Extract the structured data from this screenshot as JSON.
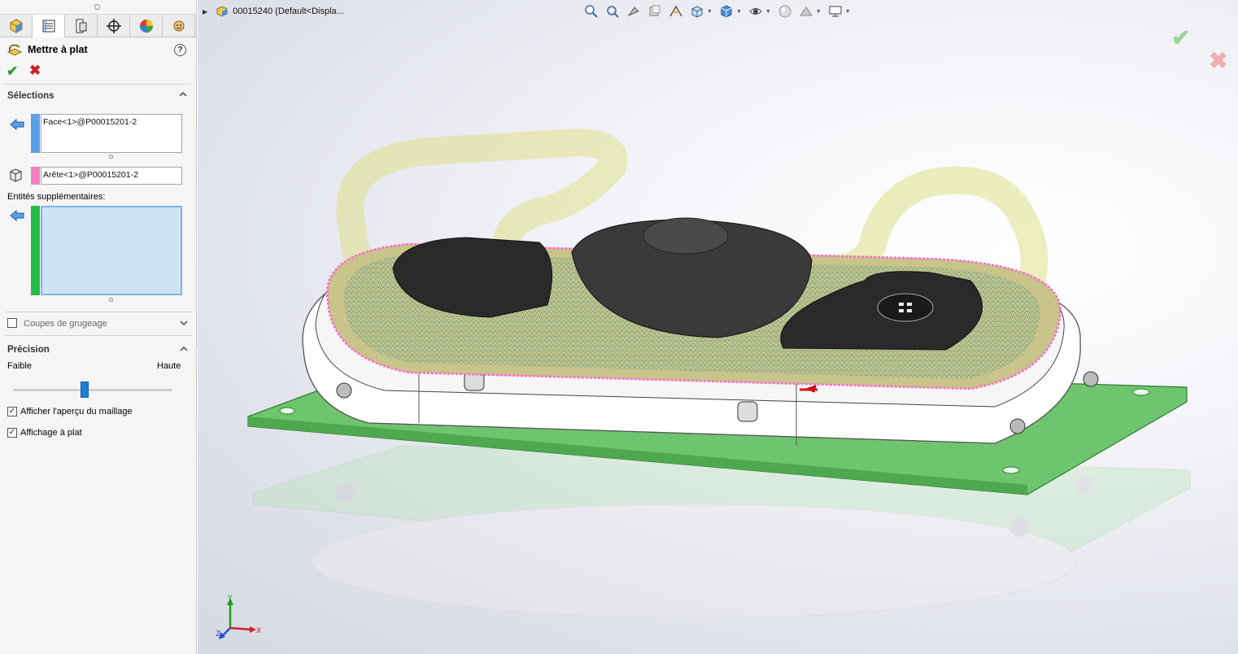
{
  "panel": {
    "title": "Mettre à plat",
    "help": "?",
    "ok": "✔",
    "cancel": "✖",
    "tabs": [
      "feature-manager",
      "property-manager",
      "configuration-manager",
      "dimxpert-manager",
      "display-manager",
      "appearance"
    ],
    "selections": {
      "header": "Sélections",
      "face_value": "Face<1>@P00015201-2",
      "edge_value": "Arête<1>@P00015201-2",
      "additional_label": "Entités supplémentaires:",
      "additional_value": ""
    },
    "relief": {
      "label": "Coupes de grugeage",
      "checked": false
    },
    "precision": {
      "header": "Précision",
      "low_label": "Faible",
      "high_label": "Haute",
      "slider_value": 0.45
    },
    "options": [
      {
        "label": "Afficher l'aperçu du maillage",
        "checked": true
      },
      {
        "label": "Affichage à plat",
        "checked": true
      }
    ],
    "colors": {
      "face": "#5aa0e6",
      "edge": "#f07fc0",
      "additional": "#22bb44",
      "accent": "#1e7fd6"
    }
  },
  "viewport": {
    "document_label": "00015240  (Default<Displa...",
    "toolbar_icons": [
      "zoom-to-fit-icon",
      "zoom-to-area-icon",
      "previous-view-icon",
      "section-view-icon",
      "dynamic-annotation-icon",
      "view-orientation-icon",
      "display-style-icon",
      "hide-show-icon",
      "edit-appearance-icon",
      "apply-scene-icon",
      "view-settings-icon"
    ],
    "ok": "✔",
    "cancel": "✖",
    "triad": {
      "x": "X",
      "y": "Y",
      "z": "Z"
    }
  }
}
